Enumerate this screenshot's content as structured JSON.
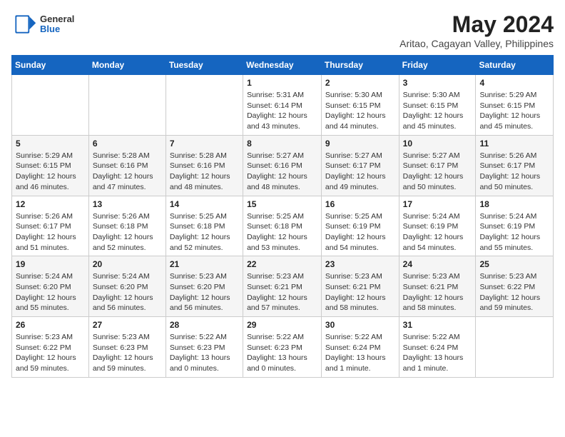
{
  "header": {
    "logo": {
      "line1": "General",
      "line2": "Blue"
    },
    "title": "May 2024",
    "location": "Aritao, Cagayan Valley, Philippines"
  },
  "days_of_week": [
    "Sunday",
    "Monday",
    "Tuesday",
    "Wednesday",
    "Thursday",
    "Friday",
    "Saturday"
  ],
  "weeks": [
    [
      {
        "day": "",
        "info": ""
      },
      {
        "day": "",
        "info": ""
      },
      {
        "day": "",
        "info": ""
      },
      {
        "day": "1",
        "info": "Sunrise: 5:31 AM\nSunset: 6:14 PM\nDaylight: 12 hours\nand 43 minutes."
      },
      {
        "day": "2",
        "info": "Sunrise: 5:30 AM\nSunset: 6:15 PM\nDaylight: 12 hours\nand 44 minutes."
      },
      {
        "day": "3",
        "info": "Sunrise: 5:30 AM\nSunset: 6:15 PM\nDaylight: 12 hours\nand 45 minutes."
      },
      {
        "day": "4",
        "info": "Sunrise: 5:29 AM\nSunset: 6:15 PM\nDaylight: 12 hours\nand 45 minutes."
      }
    ],
    [
      {
        "day": "5",
        "info": "Sunrise: 5:29 AM\nSunset: 6:15 PM\nDaylight: 12 hours\nand 46 minutes."
      },
      {
        "day": "6",
        "info": "Sunrise: 5:28 AM\nSunset: 6:16 PM\nDaylight: 12 hours\nand 47 minutes."
      },
      {
        "day": "7",
        "info": "Sunrise: 5:28 AM\nSunset: 6:16 PM\nDaylight: 12 hours\nand 48 minutes."
      },
      {
        "day": "8",
        "info": "Sunrise: 5:27 AM\nSunset: 6:16 PM\nDaylight: 12 hours\nand 48 minutes."
      },
      {
        "day": "9",
        "info": "Sunrise: 5:27 AM\nSunset: 6:17 PM\nDaylight: 12 hours\nand 49 minutes."
      },
      {
        "day": "10",
        "info": "Sunrise: 5:27 AM\nSunset: 6:17 PM\nDaylight: 12 hours\nand 50 minutes."
      },
      {
        "day": "11",
        "info": "Sunrise: 5:26 AM\nSunset: 6:17 PM\nDaylight: 12 hours\nand 50 minutes."
      }
    ],
    [
      {
        "day": "12",
        "info": "Sunrise: 5:26 AM\nSunset: 6:17 PM\nDaylight: 12 hours\nand 51 minutes."
      },
      {
        "day": "13",
        "info": "Sunrise: 5:26 AM\nSunset: 6:18 PM\nDaylight: 12 hours\nand 52 minutes."
      },
      {
        "day": "14",
        "info": "Sunrise: 5:25 AM\nSunset: 6:18 PM\nDaylight: 12 hours\nand 52 minutes."
      },
      {
        "day": "15",
        "info": "Sunrise: 5:25 AM\nSunset: 6:18 PM\nDaylight: 12 hours\nand 53 minutes."
      },
      {
        "day": "16",
        "info": "Sunrise: 5:25 AM\nSunset: 6:19 PM\nDaylight: 12 hours\nand 54 minutes."
      },
      {
        "day": "17",
        "info": "Sunrise: 5:24 AM\nSunset: 6:19 PM\nDaylight: 12 hours\nand 54 minutes."
      },
      {
        "day": "18",
        "info": "Sunrise: 5:24 AM\nSunset: 6:19 PM\nDaylight: 12 hours\nand 55 minutes."
      }
    ],
    [
      {
        "day": "19",
        "info": "Sunrise: 5:24 AM\nSunset: 6:20 PM\nDaylight: 12 hours\nand 55 minutes."
      },
      {
        "day": "20",
        "info": "Sunrise: 5:24 AM\nSunset: 6:20 PM\nDaylight: 12 hours\nand 56 minutes."
      },
      {
        "day": "21",
        "info": "Sunrise: 5:23 AM\nSunset: 6:20 PM\nDaylight: 12 hours\nand 56 minutes."
      },
      {
        "day": "22",
        "info": "Sunrise: 5:23 AM\nSunset: 6:21 PM\nDaylight: 12 hours\nand 57 minutes."
      },
      {
        "day": "23",
        "info": "Sunrise: 5:23 AM\nSunset: 6:21 PM\nDaylight: 12 hours\nand 58 minutes."
      },
      {
        "day": "24",
        "info": "Sunrise: 5:23 AM\nSunset: 6:21 PM\nDaylight: 12 hours\nand 58 minutes."
      },
      {
        "day": "25",
        "info": "Sunrise: 5:23 AM\nSunset: 6:22 PM\nDaylight: 12 hours\nand 59 minutes."
      }
    ],
    [
      {
        "day": "26",
        "info": "Sunrise: 5:23 AM\nSunset: 6:22 PM\nDaylight: 12 hours\nand 59 minutes."
      },
      {
        "day": "27",
        "info": "Sunrise: 5:23 AM\nSunset: 6:23 PM\nDaylight: 12 hours\nand 59 minutes."
      },
      {
        "day": "28",
        "info": "Sunrise: 5:22 AM\nSunset: 6:23 PM\nDaylight: 13 hours\nand 0 minutes."
      },
      {
        "day": "29",
        "info": "Sunrise: 5:22 AM\nSunset: 6:23 PM\nDaylight: 13 hours\nand 0 minutes."
      },
      {
        "day": "30",
        "info": "Sunrise: 5:22 AM\nSunset: 6:24 PM\nDaylight: 13 hours\nand 1 minute."
      },
      {
        "day": "31",
        "info": "Sunrise: 5:22 AM\nSunset: 6:24 PM\nDaylight: 13 hours\nand 1 minute."
      },
      {
        "day": "",
        "info": ""
      }
    ]
  ]
}
